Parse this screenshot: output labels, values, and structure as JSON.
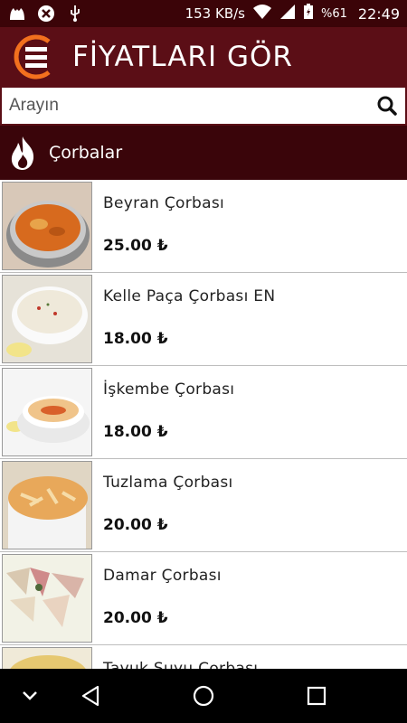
{
  "status_bar": {
    "speed": "153 KB/s",
    "battery": "%61",
    "time": "22:49"
  },
  "app_bar": {
    "title": "FİYATLARI GÖR"
  },
  "search": {
    "placeholder": "Arayın"
  },
  "category": {
    "title": "Çorbalar"
  },
  "items": [
    {
      "name": "Beyran Çorbası",
      "price": "25.00 ₺"
    },
    {
      "name": "Kelle Paça Çorbası EN",
      "price": "18.00 ₺"
    },
    {
      "name": "İşkembe Çorbası",
      "price": "18.00 ₺"
    },
    {
      "name": "Tuzlama Çorbası",
      "price": "20.00 ₺"
    },
    {
      "name": "Damar Çorbası",
      "price": "20.00 ₺"
    },
    {
      "name": "Tavuk Suyu Çorbası",
      "price": ""
    }
  ],
  "colors": {
    "app_bar": "#5b0e16",
    "category_bar": "#3a050a",
    "accent_orange": "#f2701e"
  },
  "icons": {
    "menu": "hamburger-menu-icon",
    "search": "search-icon",
    "category": "flame-icon",
    "nav_back": "back-triangle-icon",
    "nav_home": "home-circle-icon",
    "nav_recents": "recents-square-icon",
    "nav_down": "chevron-down-icon"
  }
}
